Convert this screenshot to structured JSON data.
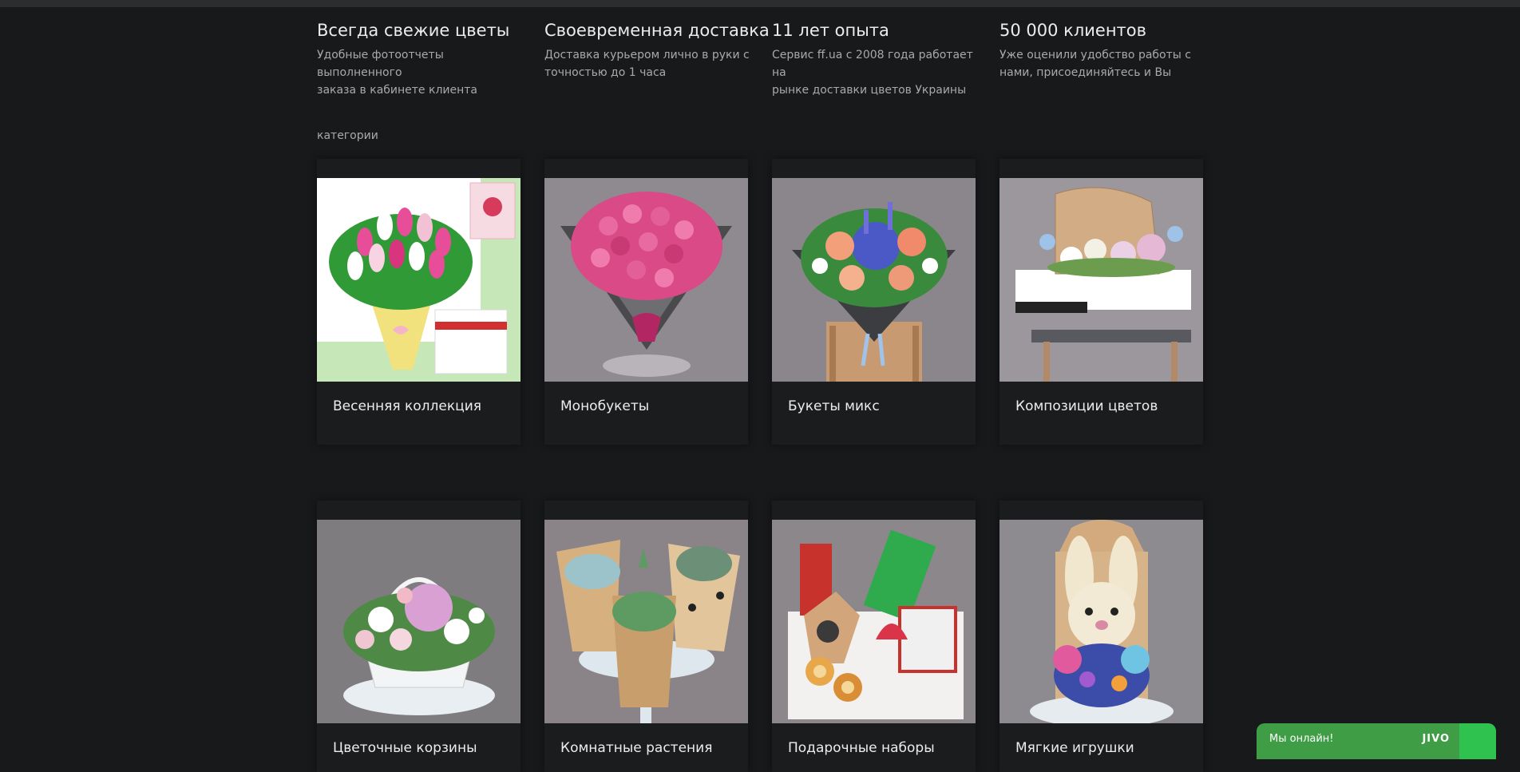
{
  "features": [
    {
      "title": "Всегда свежие цветы",
      "desc_line1": "Удобные фотоотчеты выполненного",
      "desc_line2": "заказа в кабинете клиента"
    },
    {
      "title": "Своевременная доставка",
      "desc_line1": "Доставка курьером лично в руки с",
      "desc_line2": "точностью до 1 часа"
    },
    {
      "title": "11 лет опыта",
      "desc_line1": "Сервис ff.ua с 2008 года работает на",
      "desc_line2": "рынке доставки цветов Украины"
    },
    {
      "title": "50 000 клиентов",
      "desc_line1": "Уже оценили удобство работы с",
      "desc_line2": "нами, присоединяйтесь и Вы"
    }
  ],
  "categories_label": "категории",
  "categories": [
    {
      "label": "Весенняя коллекция"
    },
    {
      "label": "Монобукеты"
    },
    {
      "label": "Букеты микс"
    },
    {
      "label": "Композиции цветов"
    },
    {
      "label": "Цветочные корзины"
    },
    {
      "label": "Комнатные растения"
    },
    {
      "label": "Подарочные наборы"
    },
    {
      "label": "Мягкие игрушки"
    }
  ],
  "chat": {
    "status": "Мы онлайн!",
    "logo": "JIVO"
  },
  "colors": {
    "background": "#18191b",
    "card": "#1b1c1e",
    "chat_green": "#3f9d45"
  }
}
